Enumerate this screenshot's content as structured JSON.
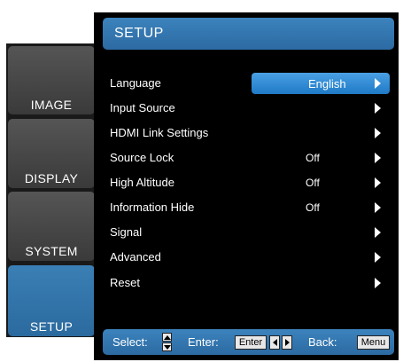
{
  "nav": {
    "tabs": [
      {
        "label": "IMAGE",
        "active": false
      },
      {
        "label": "DISPLAY",
        "active": false
      },
      {
        "label": "SYSTEM",
        "active": false
      },
      {
        "label": "SETUP",
        "active": true
      }
    ]
  },
  "panel": {
    "title": "SETUP",
    "items": [
      {
        "label": "Language",
        "value": "English"
      },
      {
        "label": "Input Source",
        "value": ""
      },
      {
        "label": "HDMI Link Settings",
        "value": ""
      },
      {
        "label": "Source Lock",
        "value": "Off"
      },
      {
        "label": "High Altitude",
        "value": "Off"
      },
      {
        "label": "Information Hide",
        "value": "Off"
      },
      {
        "label": "Signal",
        "value": ""
      },
      {
        "label": "Advanced",
        "value": ""
      },
      {
        "label": "Reset",
        "value": ""
      }
    ]
  },
  "footer": {
    "select_label": "Select:",
    "enter_label": "Enter:",
    "enter_key": "Enter",
    "back_label": "Back:",
    "back_key": "Menu"
  },
  "colors": {
    "accent": "#2c6aa2",
    "highlight": "#3b8fd8",
    "tab_inactive": "#4a4a4a",
    "panel_bg": "#000000"
  }
}
